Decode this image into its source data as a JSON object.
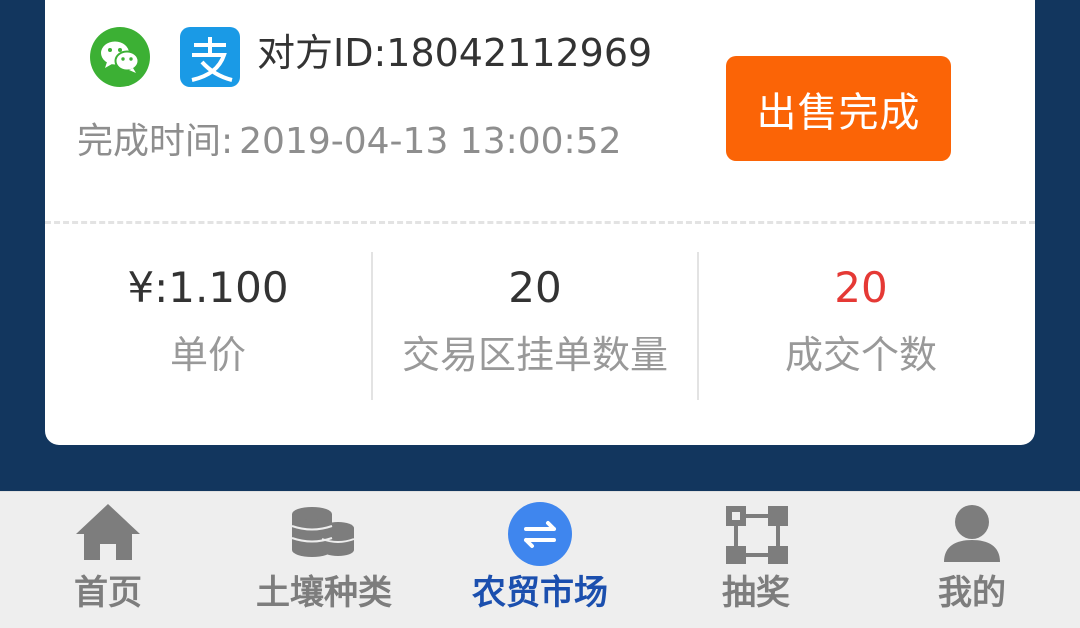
{
  "order": {
    "peer_id": "对方ID:18042112969",
    "completion_label": "完成时间:",
    "completion_time": "2019-04-13 13:00:52",
    "status_button": "出售完成",
    "payment_methods": [
      "wechat-pay",
      "alipay"
    ]
  },
  "stats": [
    {
      "value": "¥:1.100",
      "label": "单价"
    },
    {
      "value": "20",
      "label": "交易区挂单数量"
    },
    {
      "value": "20",
      "label": "成交个数"
    }
  ],
  "tabbar": {
    "items": [
      {
        "label": "首页",
        "icon": "home-icon"
      },
      {
        "label": "土壤种类",
        "icon": "coins-stack-icon"
      },
      {
        "label": "农贸市场",
        "icon": "exchange-icon",
        "active": true
      },
      {
        "label": "抽奖",
        "icon": "network-grid-icon"
      },
      {
        "label": "我的",
        "icon": "user-icon"
      }
    ]
  },
  "colors": {
    "background": "#12365e",
    "accent_orange": "#fb6406",
    "active_tab": "#1b4fae",
    "highlight_red": "#e53935"
  }
}
